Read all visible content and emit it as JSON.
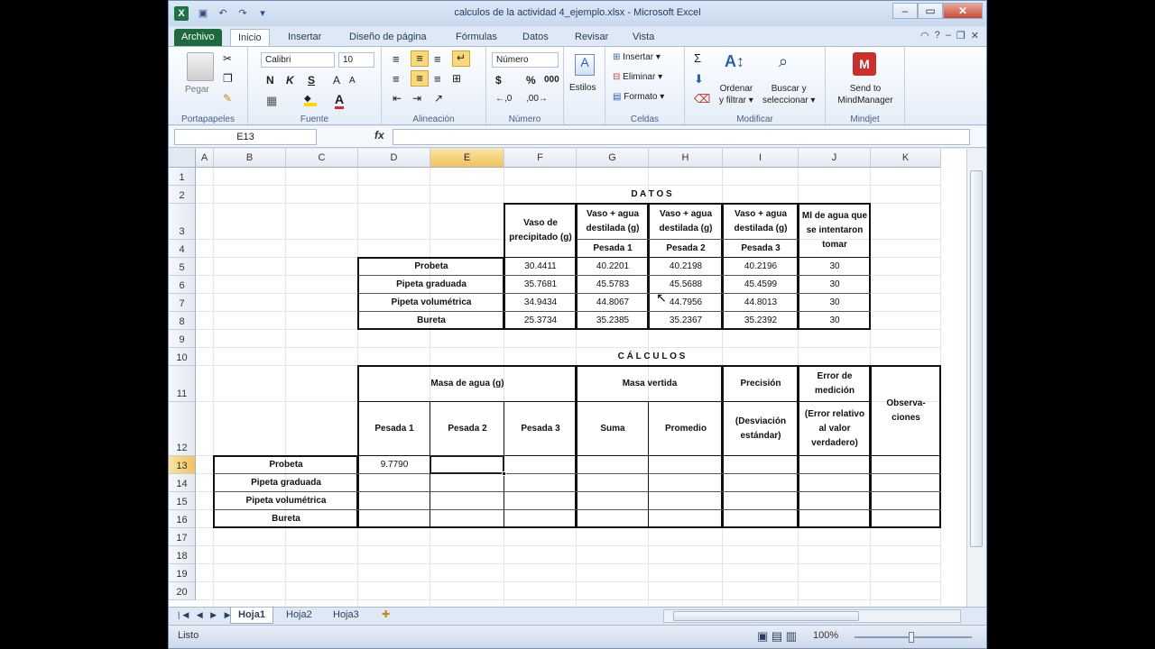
{
  "window": {
    "title": "calculos de la actividad 4_ejemplo.xlsx - Microsoft Excel",
    "app_icon": "X"
  },
  "ribbon_tabs": [
    "Archivo",
    "Inicio",
    "Insertar",
    "Diseño de página",
    "Fórmulas",
    "Datos",
    "Revisar",
    "Vista"
  ],
  "ribbon": {
    "paste": "Pegar",
    "clipboard": "Portapapeles",
    "font_name": "Calibri",
    "font_size": "10",
    "bold": "N",
    "italic": "K",
    "underline": "S",
    "font_group": "Fuente",
    "align_group": "Alineación",
    "number_format": "Número",
    "number_group": "Número",
    "currency": "$",
    "percent": "%",
    "thousands": "000",
    "styles": "Estilos",
    "insert": "Insertar",
    "delete": "Eliminar",
    "format": "Formato",
    "cells_group": "Celdas",
    "sort_filter_1": "Ordenar",
    "sort_filter_2": "y filtrar",
    "find_select_1": "Buscar y",
    "find_select_2": "seleccionar",
    "modify_group": "Modificar",
    "mindmanager_1": "Send to",
    "mindmanager_2": "MindManager",
    "mindjet_group": "Mindjet",
    "sum": "Σ"
  },
  "formula_bar": {
    "name_box": "E13",
    "fx": "fx",
    "content": ""
  },
  "columns": [
    "A",
    "B",
    "C",
    "D",
    "E",
    "F",
    "G",
    "H",
    "I",
    "J",
    "K"
  ],
  "rows": [
    "1",
    "2",
    "3",
    "4",
    "5",
    "6",
    "7",
    "8",
    "9",
    "10",
    "11",
    "12",
    "13",
    "14",
    "15",
    "16",
    "17",
    "18",
    "19",
    "20"
  ],
  "selected_cell": {
    "col": "E",
    "row": "13"
  },
  "datos": {
    "title": "D A T O S",
    "headers": {
      "vaso_precipitado": "Vaso de precipitado (g)",
      "vaso_agua_1": "Vaso + agua destilada (g)",
      "vaso_agua_2": "Vaso + agua destilada (g)",
      "vaso_agua_3": "Vaso + agua destilada (g)",
      "ml_agua": "Ml de agua que se intentaron tomar",
      "pesada_1": "Pesada 1",
      "pesada_2": "Pesada 2",
      "pesada_3": "Pesada 3"
    },
    "rows": [
      {
        "label": "Probeta",
        "f": "30.4411",
        "g": "40.2201",
        "h": "40.2198",
        "i": "40.2196",
        "j": "30"
      },
      {
        "label": "Pipeta graduada",
        "f": "35.7681",
        "g": "45.5783",
        "h": "45.5688",
        "i": "45.4599",
        "j": "30"
      },
      {
        "label": "Pipeta volumétrica",
        "f": "34.9434",
        "g": "44.8067",
        "h": "44.7956",
        "i": "44.8013",
        "j": "30"
      },
      {
        "label": "Bureta",
        "f": "25.3734",
        "g": "35.2385",
        "h": "35.2367",
        "i": "35.2392",
        "j": "30"
      }
    ]
  },
  "calculos": {
    "title": "C Á L C U L O S",
    "masa_agua": "Masa de agua (g)",
    "masa_vertida": "Masa vertida",
    "precision": "Precisión",
    "error_medicion": "Error de medición",
    "observaciones": "Observa-ciones",
    "pesada_1": "Pesada 1",
    "pesada_2": "Pesada 2",
    "pesada_3": "Pesada 3",
    "suma": "Suma",
    "promedio": "Promedio",
    "desviacion": "(Desviación estándar)",
    "error_relativo": "(Error relativo al valor verdadero)",
    "rows": [
      {
        "label": "Probeta",
        "d": "9.7790"
      },
      {
        "label": "Pipeta graduada",
        "d": ""
      },
      {
        "label": "Pipeta volumétrica",
        "d": ""
      },
      {
        "label": "Bureta",
        "d": ""
      }
    ]
  },
  "sheets": [
    "Hoja1",
    "Hoja2",
    "Hoja3"
  ],
  "active_sheet": "Hoja1",
  "status": {
    "mode": "Listo",
    "zoom": "100%"
  }
}
